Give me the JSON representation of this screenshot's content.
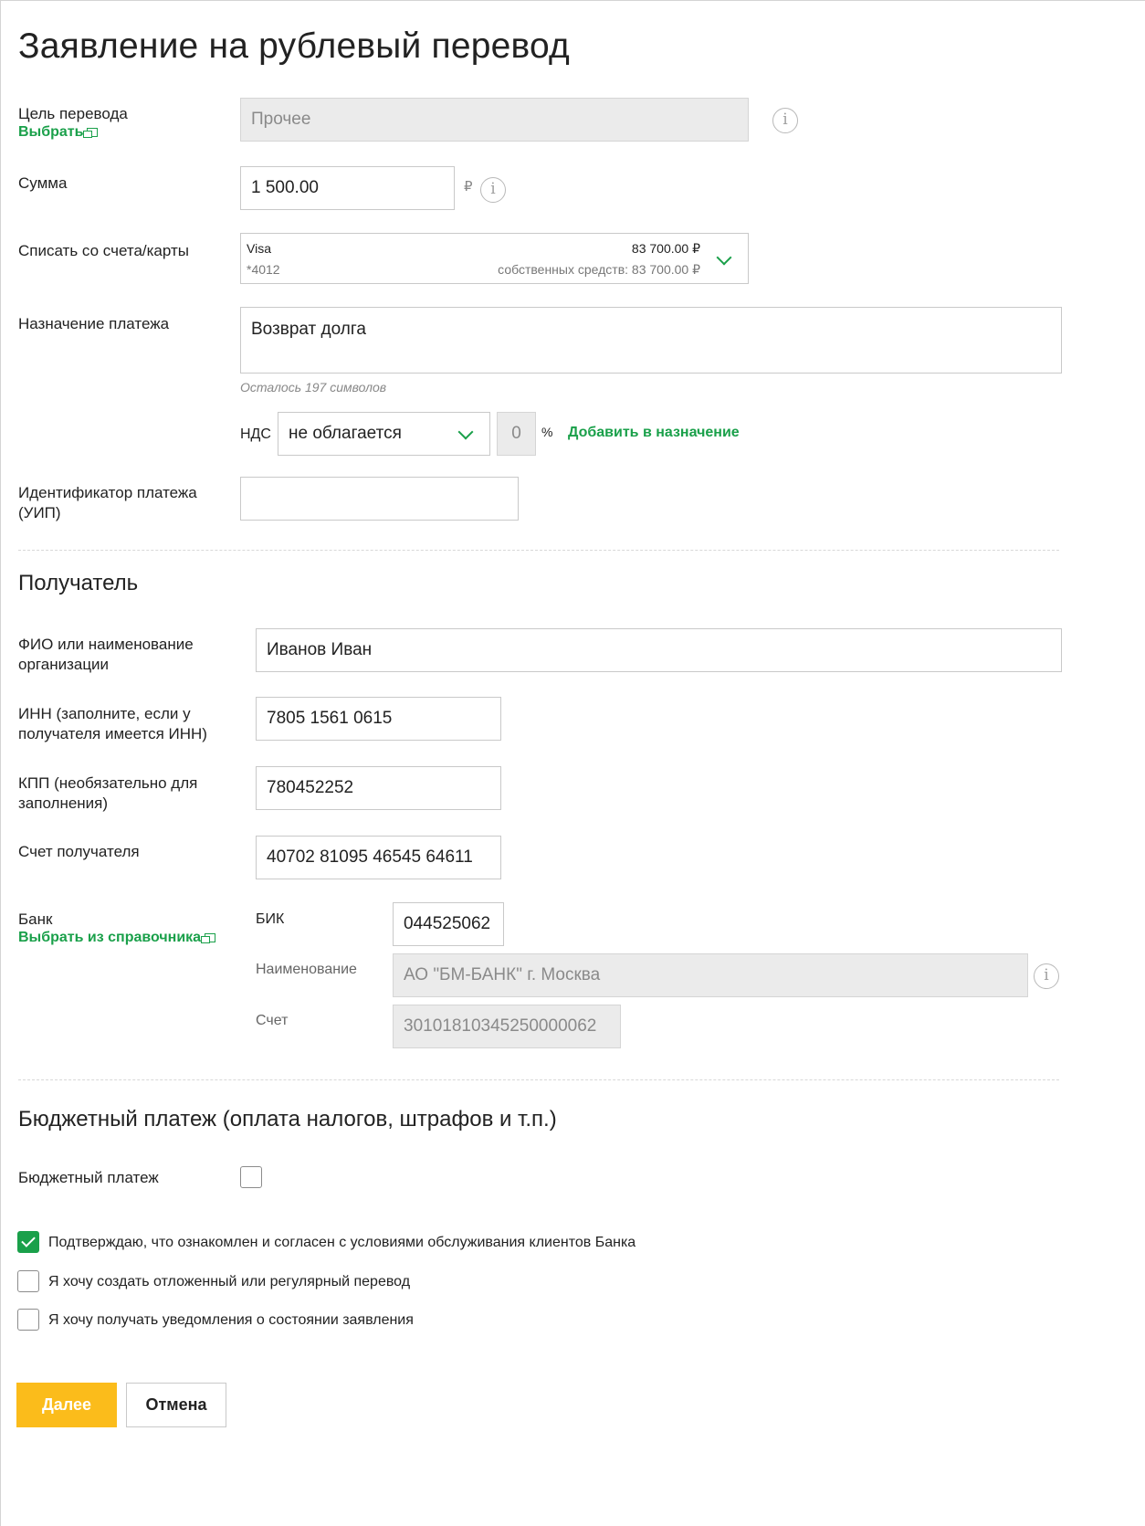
{
  "header": {
    "title": "Заявление на рублевый перевод"
  },
  "purpose": {
    "label": "Цель перевода",
    "choose_link": "Выбрать",
    "value": "Прочее"
  },
  "amount": {
    "label": "Сумма",
    "value": "1 500.00",
    "currency": "₽"
  },
  "debit_account": {
    "label": "Списать со счета/карты",
    "card_name": "Visa",
    "card_number": "*4012",
    "balance": "83 700.00 ₽",
    "own_funds": "собственных средств: 83 700.00 ₽"
  },
  "payment_purpose": {
    "label": "Назначение платежа",
    "value": "Возврат долга",
    "remaining": "Осталось 197 символов"
  },
  "vat": {
    "label": "НДС",
    "selected": "не облагается",
    "rate": "0",
    "percent_sign": "%",
    "add_link": "Добавить в назначение"
  },
  "uip": {
    "label": "Идентификатор платежа (УИП)",
    "value": ""
  },
  "recipient": {
    "section_title": "Получатель",
    "name_label": "ФИО или наименование организации",
    "name_value": "Иванов Иван",
    "inn_label": "ИНН (заполните, если у получателя имеется ИНН)",
    "inn_value": "7805 1561 0615",
    "kpp_label": "КПП (необязательно для заполнения)",
    "kpp_value": "780452252",
    "account_label": "Счет получателя",
    "account_value": "40702 81095 46545 64611"
  },
  "bank": {
    "label": "Банк",
    "directory_link": "Выбрать из справочника",
    "bik_label": "БИК",
    "bik_value": "044525062",
    "name_label": "Наименование",
    "name_value": "АО \"БМ-БАНК\" г. Москва",
    "account_label": "Счет",
    "account_value": "30101810345250000062"
  },
  "budget": {
    "section_title": "Бюджетный платеж (оплата налогов, штрафов и т.п.)",
    "checkbox_label": "Бюджетный платеж",
    "checked": false
  },
  "agreements": [
    {
      "label": "Подтверждаю, что ознакомлен и согласен с условиями обслуживания клиентов Банка",
      "checked": true
    },
    {
      "label": "Я хочу создать отложенный или регулярный перевод",
      "checked": false
    },
    {
      "label": "Я хочу получать уведомления о состоянии заявления",
      "checked": false
    }
  ],
  "actions": {
    "next_label": "Далее",
    "cancel_label": "Отмена"
  },
  "icons": {
    "info": "info-icon",
    "external_link": "external-link-icon",
    "dropdown": "chevron-down-icon"
  },
  "colors": {
    "accent_green": "#1aa04a",
    "primary_button": "#fbbc1b",
    "disabled_field": "#ebebeb"
  }
}
